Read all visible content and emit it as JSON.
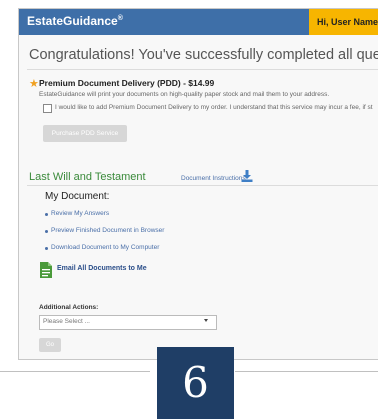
{
  "header": {
    "brand": "EstateGuidance",
    "brand_mark": "®",
    "user_greeting": "Hi, User Name"
  },
  "main": {
    "congrats": "Congratulations! You've successfully completed all questionnaire",
    "pdd": {
      "title": "Premium Document Delivery (PDD) - $14.99",
      "description": "EstateGuidance will print your documents on high-quality paper stock and mail them to your address.",
      "checkbox_label": "I would like to add Premium Document Delivery to my order. I understand that this service may incur a fee, if st",
      "checked": false,
      "purchase_button": "Purchase PDD Service"
    },
    "last_will": {
      "title": "Last Will and Testament",
      "instructions_link": "Document Instructions"
    },
    "my_document": {
      "heading": "My Document:",
      "links": [
        "Review My Answers",
        "Preview Finished Document in Browser",
        "Download Document to My Computer"
      ]
    },
    "email_link": "Email All Documents to Me",
    "additional_actions": {
      "label": "Additional Actions:",
      "select_value": "Please Select ...",
      "go_button": "Go"
    }
  },
  "badge": {
    "number": "6"
  },
  "colors": {
    "header_bg": "#3e6fa8",
    "user_bg": "#f7b500",
    "heading_green": "#3a8a3a",
    "link_blue": "#4a6fa8",
    "badge_navy": "#1f3e66"
  },
  "icons": {
    "pdd_star": "star-icon",
    "instructions": "download-icon",
    "email": "document-icon"
  }
}
